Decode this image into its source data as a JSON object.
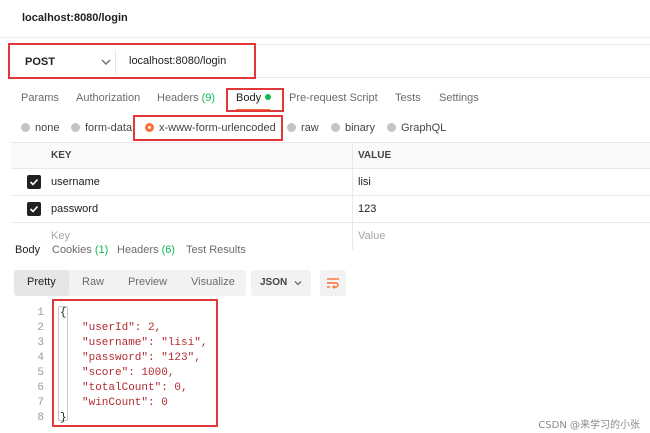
{
  "window": {
    "title": "localhost:8080/login"
  },
  "request": {
    "method": "POST",
    "url": "localhost:8080/login"
  },
  "request_tabs": [
    {
      "label": "Params"
    },
    {
      "label": "Authorization"
    },
    {
      "label": "Headers",
      "count": "(9)"
    },
    {
      "label": "Body"
    },
    {
      "label": "Pre-request Script"
    },
    {
      "label": "Tests"
    },
    {
      "label": "Settings"
    }
  ],
  "body_modes": [
    "none",
    "form-data",
    "x-www-form-urlencoded",
    "raw",
    "binary",
    "GraphQL"
  ],
  "body_mode_selected": "x-www-form-urlencoded",
  "params_table": {
    "headers": [
      "KEY",
      "VALUE"
    ],
    "rows": [
      {
        "checked": true,
        "key": "username",
        "value": "lisi"
      },
      {
        "checked": true,
        "key": "password",
        "value": "123"
      }
    ],
    "placeholder": {
      "key": "Key",
      "value": "Value"
    }
  },
  "response_tabs": [
    {
      "label": "Body"
    },
    {
      "label": "Cookies",
      "count": "(1)"
    },
    {
      "label": "Headers",
      "count": "(6)"
    },
    {
      "label": "Test Results"
    }
  ],
  "view_modes": [
    "Pretty",
    "Raw",
    "Preview",
    "Visualize"
  ],
  "format": "JSON",
  "response_lines": [
    "{",
    "\"userId\": 2,",
    "\"username\": \"lisi\",",
    "\"password\": \"123\",",
    "\"score\": 1000,",
    "\"totalCount\": 0,",
    "\"winCount\": 0",
    "}"
  ],
  "line_numbers": [
    "1",
    "2",
    "3",
    "4",
    "5",
    "6",
    "7",
    "8"
  ],
  "watermark": "CSDN @来学习的小张",
  "colors": {
    "accent": "#ff6c37",
    "success": "#0cbb52",
    "highlight": "#e0373b"
  }
}
